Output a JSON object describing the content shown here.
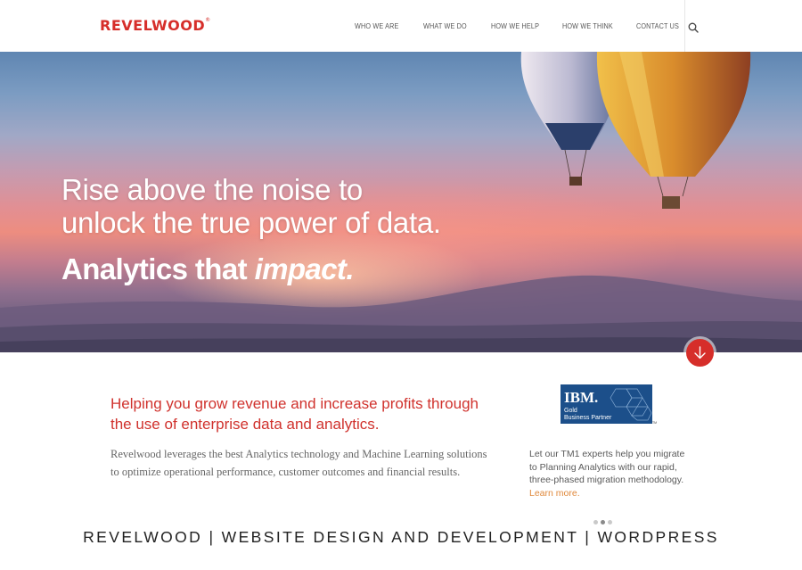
{
  "header": {
    "logo_text": "REVELWOOD",
    "logo_tm": "®",
    "nav": [
      "WHO WE ARE",
      "WHAT WE DO",
      "HOW WE HELP",
      "HOW WE THINK",
      "CONTACT US"
    ],
    "search_icon": "search-icon"
  },
  "hero": {
    "line1": "Rise above the noise to",
    "line2": "unlock the true power of data.",
    "tagline_main": "Analytics that ",
    "tagline_emphasis": "impact.",
    "scroll_icon": "arrow-down-icon"
  },
  "intro": {
    "heading": "Helping you grow revenue and increase profits through the use of enterprise data and analytics.",
    "body": "Revelwood leverages the best Analytics technology and Machine Learning solutions to optimize operational performance, customer outcomes and financial results."
  },
  "ibm": {
    "logo_text": "IBM.",
    "partner_line1": "Gold",
    "partner_line2": "Business Partner",
    "tm": "TM",
    "description": "Let our TM1 experts help you migrate to Planning Analytics with our rapid, three-phased migration methodology.",
    "link_text": "Learn more."
  },
  "carousel": {
    "active_index": 1,
    "count": 3
  },
  "caption": "REVELWOOD | WEBSITE DESIGN AND DEVELOPMENT | WORDPRESS",
  "colors": {
    "brand_red": "#d62e2a",
    "link_orange": "#e08a3e",
    "ibm_blue": "#1c4f8a"
  }
}
